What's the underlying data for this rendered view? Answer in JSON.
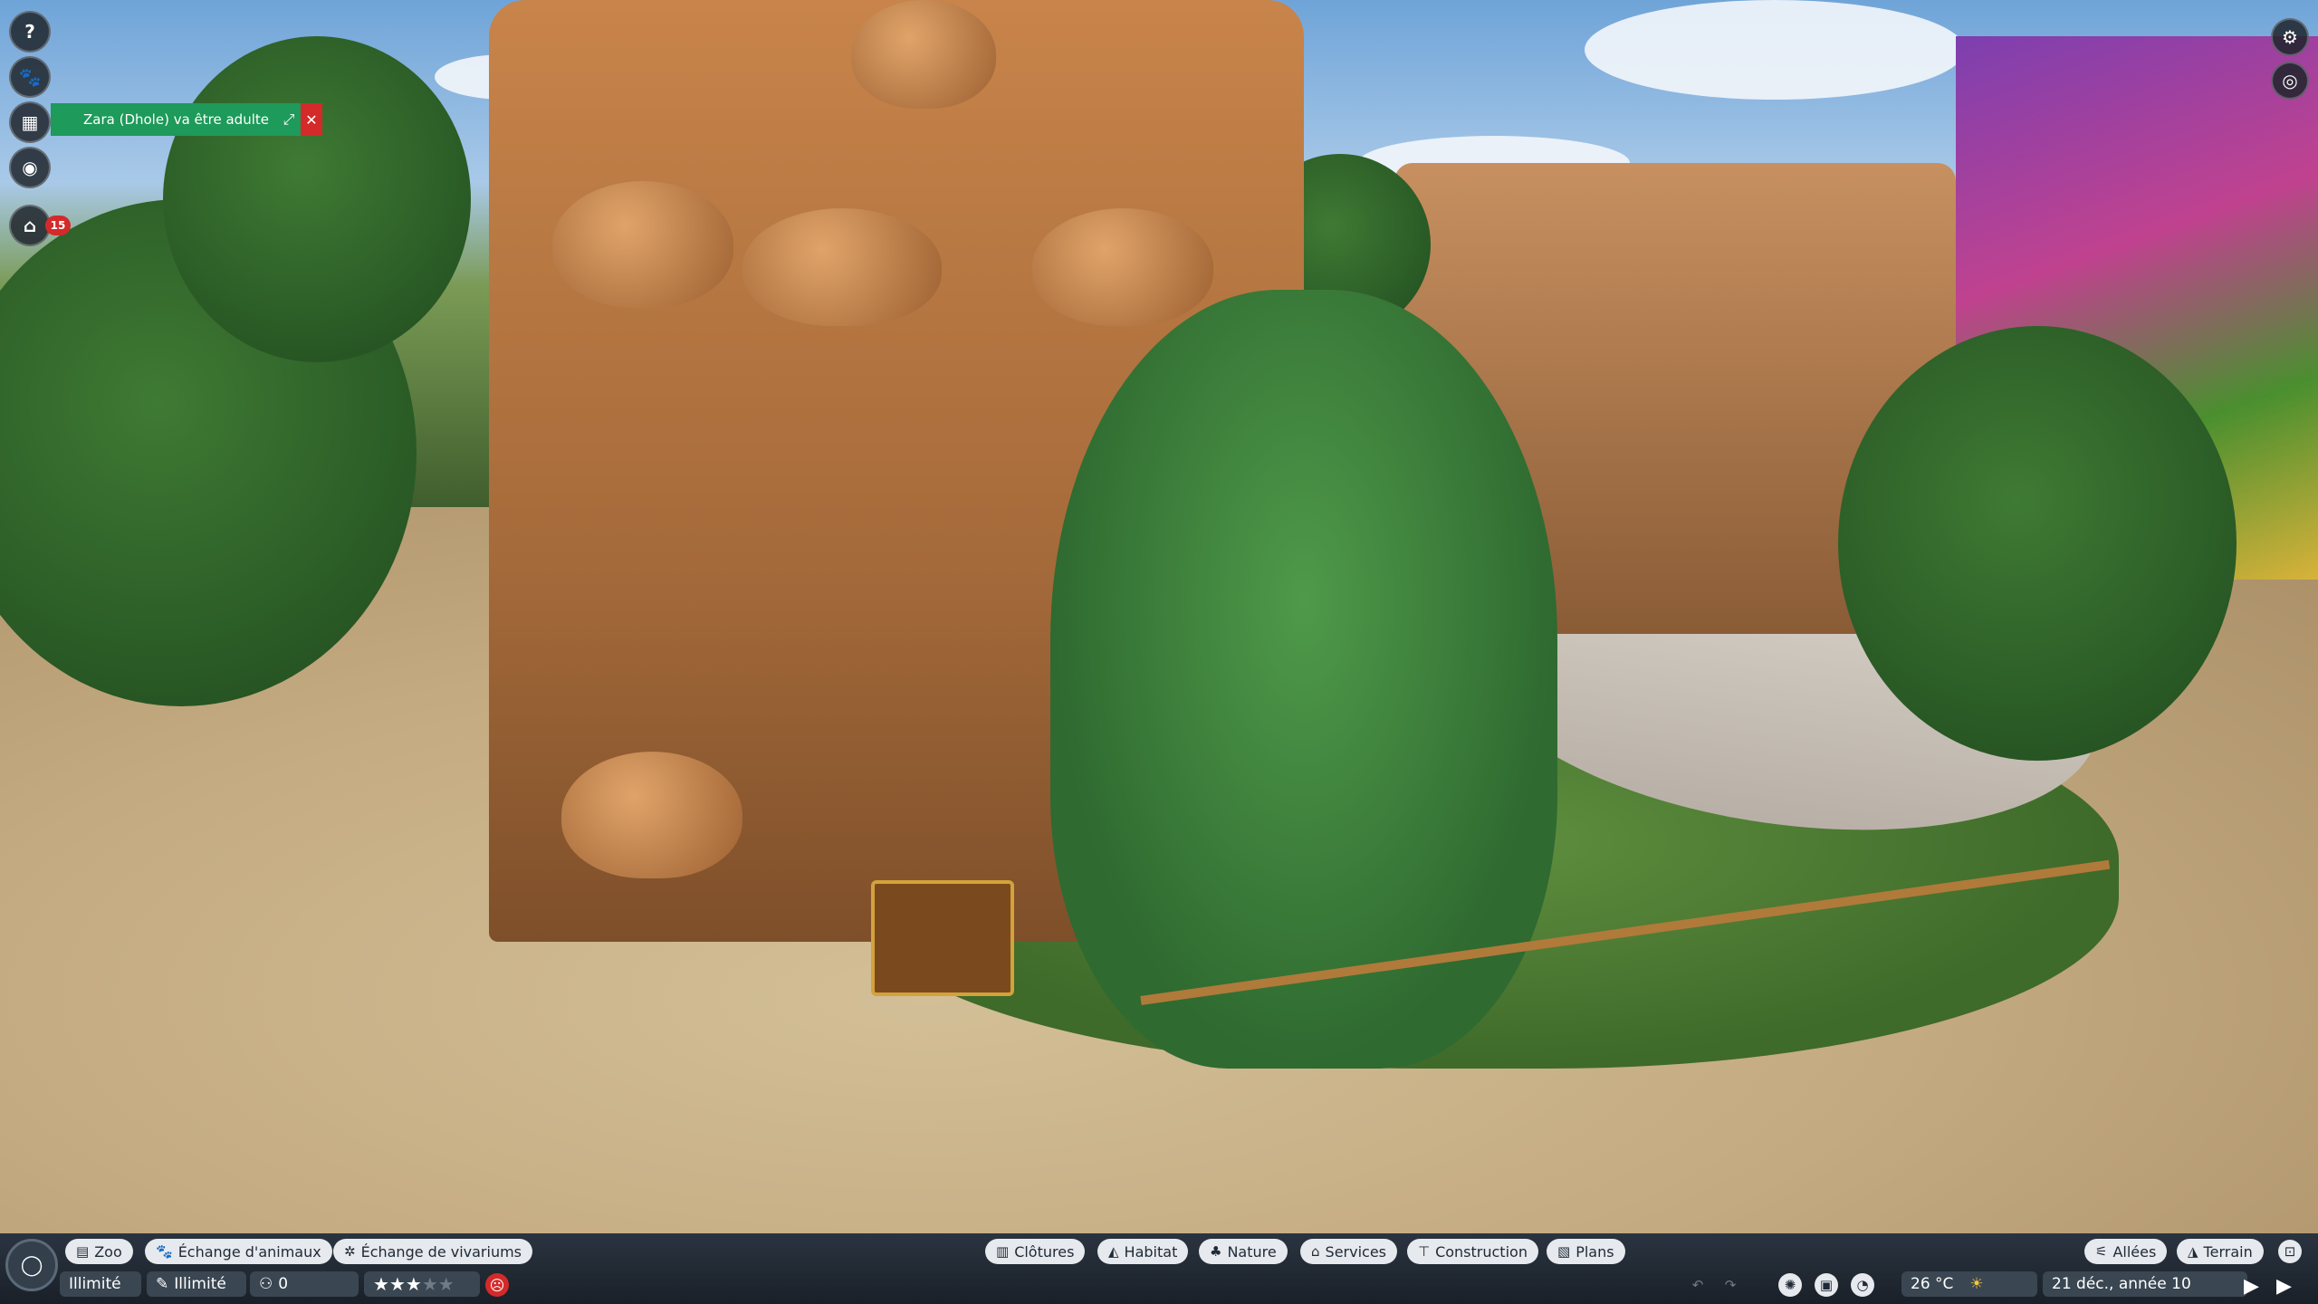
{
  "notification": {
    "text": "Zara (Dhole) va être adulte"
  },
  "left_hud": {
    "help_glyph": "?",
    "badge_count": "15"
  },
  "bottom_tabs_left": [
    {
      "label": "Zoo",
      "icon": "zoo-icon"
    },
    {
      "label": "Échange d'animaux",
      "icon": "paw-icon"
    },
    {
      "label": "Échange de vivariums",
      "icon": "gear-icon"
    }
  ],
  "bottom_tabs_center": [
    {
      "label": "Clôtures",
      "icon": "fence-icon"
    },
    {
      "label": "Habitat",
      "icon": "habitat-icon"
    },
    {
      "label": "Nature",
      "icon": "tree-icon"
    },
    {
      "label": "Services",
      "icon": "shop-icon"
    },
    {
      "label": "Construction",
      "icon": "build-icon"
    },
    {
      "label": "Plans",
      "icon": "blueprint-icon"
    }
  ],
  "bottom_tabs_right": [
    {
      "label": "Allées",
      "icon": "path-icon"
    },
    {
      "label": "Terrain",
      "icon": "terrain-icon"
    }
  ],
  "status": {
    "money": "Illimité",
    "research": "Illimité",
    "guests": "0",
    "rating_stars": 3,
    "temperature": "26 °C",
    "date": "21 déc., année 10"
  },
  "colors": {
    "notification": "#1e9a5a",
    "alert": "#d42a2a",
    "tab_bg": "#e6e9ed"
  }
}
